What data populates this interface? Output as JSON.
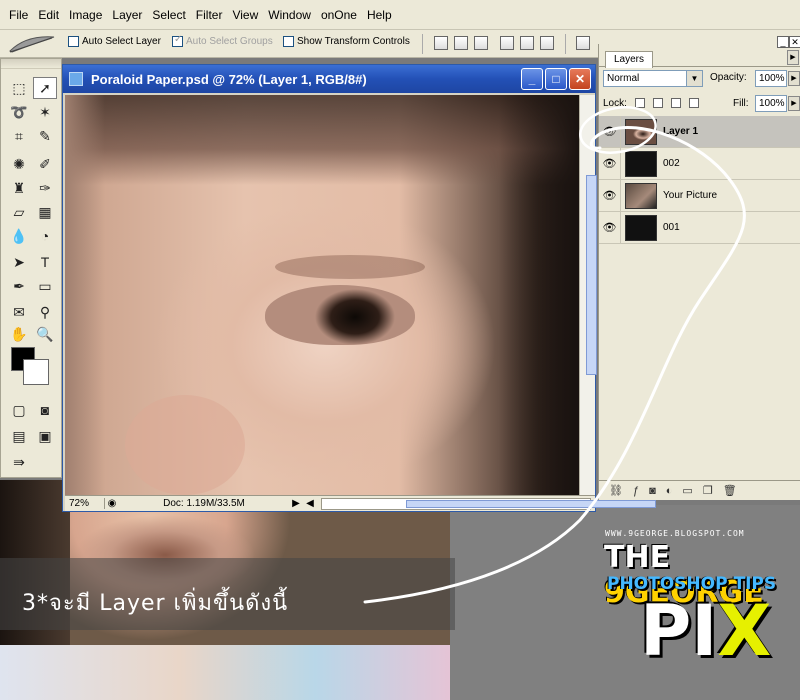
{
  "menubar": {
    "items": [
      "File",
      "Edit",
      "Image",
      "Layer",
      "Select",
      "Filter",
      "View",
      "Window",
      "onOne",
      "Help"
    ]
  },
  "options": {
    "auto_select_layer": "Auto Select Layer",
    "auto_select_groups": "Auto Select Groups",
    "show_transform_controls": "Show Transform Controls"
  },
  "document": {
    "title": "Poraloid Paper.psd @ 72% (Layer 1, RGB/8#)",
    "zoom": "72%",
    "doc_info": "Doc: 1.19M/33.5M",
    "window_buttons": {
      "minimize": "_",
      "maximize": "□",
      "close": "✕"
    }
  },
  "layers_panel": {
    "tab": "Layers",
    "blend_mode": "Normal",
    "opacity_label": "Opacity:",
    "opacity_value": "100%",
    "lock_label": "Lock:",
    "fill_label": "Fill:",
    "fill_value": "100%",
    "layers": [
      {
        "name": "Layer 1",
        "thumbnail": "face",
        "active": true
      },
      {
        "name": "002",
        "thumbnail": "dark",
        "active": false
      },
      {
        "name": "Your Picture",
        "thumbnail": "pic",
        "active": false
      },
      {
        "name": "001",
        "thumbnail": "dark",
        "active": false
      }
    ]
  },
  "annotation": {
    "text": "3*จะมี Layer เพิ่มขึ้นดังนี้"
  },
  "logo": {
    "url": "WWW.9GEORGE.BLOGSPOT.COM",
    "line1_prefix": "THE ",
    "line1_highlight": "9GEORGE",
    "line2": "PHOTOSHOP TIPS",
    "line3_main": "PI",
    "line3_x": "X"
  },
  "colors": {
    "title_bar": "#2350b6",
    "panel_bg": "#ece9d8",
    "close_button": "#c3431f",
    "logo_x": "#e6f000"
  }
}
